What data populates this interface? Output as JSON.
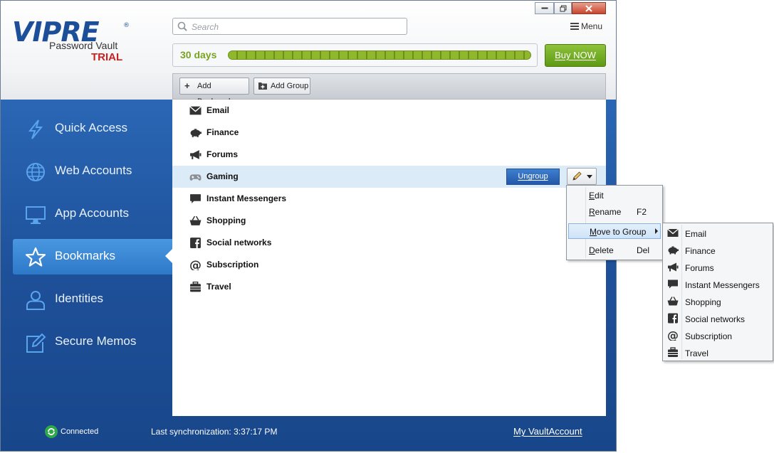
{
  "app": {
    "logo_word": "VIPRE",
    "logo_registered": "®",
    "product_name": "Password Vault",
    "edition": "TRIAL"
  },
  "window_controls": [
    "minimize",
    "restore",
    "close"
  ],
  "search": {
    "placeholder": "Search"
  },
  "menu": {
    "label": "Menu"
  },
  "trial": {
    "days_label": "30 days",
    "progress": 1.0,
    "buy_label": "Buy NOW"
  },
  "toolbar": {
    "add_bookmark": "Add Bookmark",
    "add_group": "Add Group"
  },
  "sidebar": {
    "items": [
      {
        "label": "Quick Access",
        "icon": "lightning-icon",
        "active": false
      },
      {
        "label": "Web Accounts",
        "icon": "globe-icon",
        "active": false
      },
      {
        "label": "App Accounts",
        "icon": "monitor-icon",
        "active": false
      },
      {
        "label": "Bookmarks",
        "icon": "star-icon",
        "active": true
      },
      {
        "label": "Identities",
        "icon": "person-icon",
        "active": false
      },
      {
        "label": "Secure Memos",
        "icon": "memo-edit-icon",
        "active": false
      }
    ]
  },
  "groups": [
    {
      "label": "Email",
      "icon": "envelope-icon"
    },
    {
      "label": "Finance",
      "icon": "piggy-bank-icon"
    },
    {
      "label": "Forums",
      "icon": "megaphone-icon"
    },
    {
      "label": "Gaming",
      "icon": "gamepad-icon",
      "selected": true
    },
    {
      "label": "Instant Messengers",
      "icon": "speech-bubble-icon"
    },
    {
      "label": "Shopping",
      "icon": "basket-icon"
    },
    {
      "label": "Social networks",
      "icon": "facebook-icon"
    },
    {
      "label": "Subscription",
      "icon": "at-sign-icon"
    },
    {
      "label": "Travel",
      "icon": "suitcase-icon"
    }
  ],
  "row_actions": {
    "ungroup": "Ungroup"
  },
  "context_menu": {
    "items": [
      {
        "label": "Edit",
        "shortcut": ""
      },
      {
        "label": "Rename",
        "shortcut": "F2"
      },
      {
        "label": "Move to Group",
        "shortcut": "",
        "submenu": true,
        "highlighted": true
      },
      {
        "label": "Delete",
        "shortcut": "Del"
      }
    ]
  },
  "submenu": {
    "items": [
      {
        "label": "Email",
        "icon": "envelope-icon"
      },
      {
        "label": "Finance",
        "icon": "piggy-bank-icon"
      },
      {
        "label": "Forums",
        "icon": "megaphone-icon"
      },
      {
        "label": "Instant Messengers",
        "icon": "speech-bubble-icon"
      },
      {
        "label": "Shopping",
        "icon": "basket-icon"
      },
      {
        "label": "Social networks",
        "icon": "facebook-icon"
      },
      {
        "label": "Subscription",
        "icon": "at-sign-icon"
      },
      {
        "label": "Travel",
        "icon": "suitcase-icon"
      }
    ]
  },
  "footer": {
    "connection": "Connected",
    "sync": "Last synchronization: 3:37:17 PM",
    "account_link": "My VaultAccount"
  },
  "colors": {
    "sidebar_blue": "#1f4f96",
    "active_nav": "#3b88d6",
    "trial_green": "#79a321",
    "buy_green": "#6fa71f",
    "trial_red": "#cc1f1f",
    "selected_row": "#dcebf8"
  }
}
